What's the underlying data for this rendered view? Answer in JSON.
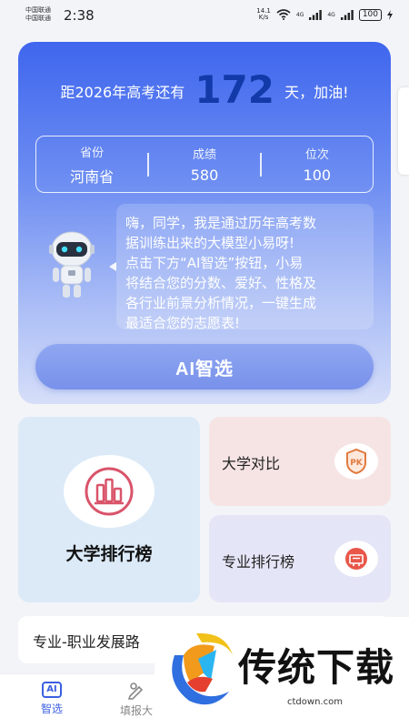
{
  "status_bar": {
    "carrier_1": "中国联通",
    "carrier_2": "中国联通",
    "time": "2:38",
    "net_speed_value": "14.1",
    "net_speed_unit": "K/s",
    "signal_1": "4G",
    "signal_2": "4G",
    "battery": "100"
  },
  "hero": {
    "countdown_prefix": "距2026年高考还有",
    "countdown_days": "172",
    "countdown_suffix": "天，加油!",
    "stats": [
      {
        "label": "省份",
        "value": "河南省"
      },
      {
        "label": "成绩",
        "value": "580"
      },
      {
        "label": "位次",
        "value": "100"
      }
    ],
    "bubble_lines": [
      "嗨，同学，我是通过历年高考数",
      "据训练出来的大模型小易呀!",
      "点击下方“AI智选”按钮，小易",
      "将结合您的分数、爱好、性格及",
      "各行业前景分析情况，一键生成",
      "最适合您的志愿表!"
    ],
    "ai_button_label": "AI智选"
  },
  "cards": {
    "ranking_label": "大学排行榜",
    "compare_label": "大学对比",
    "compare_icon_text": "PK",
    "major_label": "专业排行榜",
    "career_label": "专业-职业发展路"
  },
  "tab_bar": {
    "ai_chip": "AI",
    "ai_label": "智选",
    "fill_label": "填报大"
  },
  "watermark": {
    "title": "传统下载",
    "url": "ctdown.com"
  },
  "colors": {
    "accent": "#3b5fe0",
    "days_number": "#123aa8",
    "ranking_card_bg": "#dceaf8",
    "compare_card_bg": "#f6e4e4",
    "major_card_bg": "#e4e6f7"
  },
  "icons": {
    "ranking": "bar-chart-icon",
    "compare": "pk-badge-icon",
    "major": "podium-icon",
    "tab_fill": "pen-icon"
  }
}
